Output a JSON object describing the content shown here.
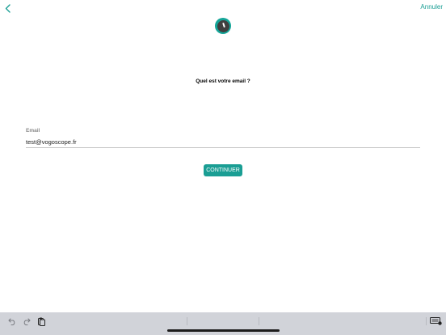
{
  "nav": {
    "back_icon": "chevron-left-icon",
    "cancel_label": "Annuler"
  },
  "logo": {
    "icon": "compass-logo-icon"
  },
  "form": {
    "question": "Quel est votre email ?",
    "email_label": "Email",
    "email_value": "test@vogoscope.fr",
    "continue_label": "CONTINUER"
  },
  "keyboard_bar": {
    "tools": [
      "undo-icon",
      "redo-icon",
      "paste-icon",
      "keyboard-dismiss-icon"
    ]
  },
  "colors": {
    "accent": "#1a9e94",
    "logo_ring": "#14a598",
    "logo_center": "#3f3f3f",
    "keyboard_bar": "#d1d3d9"
  }
}
